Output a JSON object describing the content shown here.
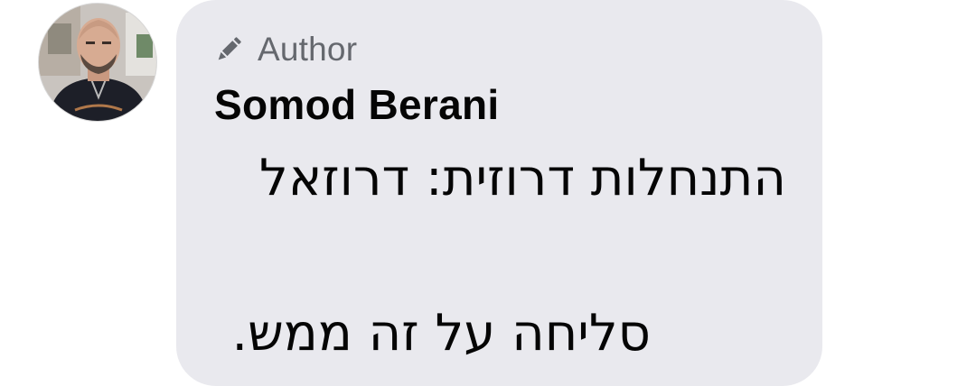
{
  "comment": {
    "author_badge": {
      "icon": "pencil-icon",
      "label": "Author"
    },
    "author_name": "Somod Berani",
    "message_lines": [
      "התנחלות דרוזית: דרוזאל",
      "סליחה על זה ממש."
    ]
  },
  "colors": {
    "bubble_background": "#e9e9ee",
    "badge_text": "#65686e",
    "text": "#050505"
  }
}
